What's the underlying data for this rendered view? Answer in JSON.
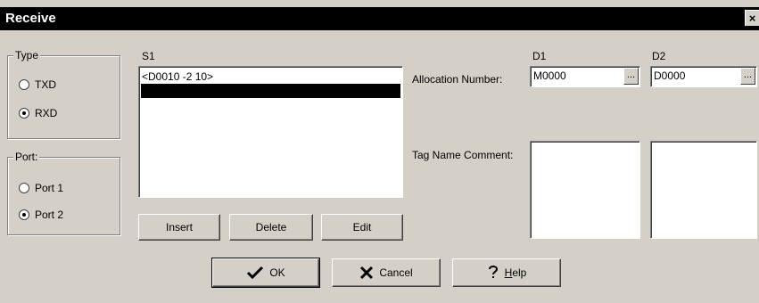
{
  "window": {
    "title": "Receive",
    "close_glyph": "×"
  },
  "type_group": {
    "label": "Type",
    "options": [
      {
        "label": "TXD",
        "checked": false
      },
      {
        "label": "RXD",
        "checked": true
      }
    ]
  },
  "port_group": {
    "label": "Port:",
    "options": [
      {
        "label": "Port 1",
        "checked": false
      },
      {
        "label": "Port 2",
        "checked": true
      }
    ]
  },
  "s1": {
    "label": "S1",
    "items": [
      "<D0010 -2 10>",
      ""
    ],
    "selected_index": 1
  },
  "list_buttons": {
    "insert": "Insert",
    "delete": "Delete",
    "edit": "Edit"
  },
  "allocation": {
    "label": "Allocation Number:",
    "d1_label": "D1",
    "d2_label": "D2",
    "d1_value": "M0000",
    "d2_value": "D0000",
    "browse_glyph": "..."
  },
  "tag_comment": {
    "label": "Tag Name Comment:"
  },
  "footer": {
    "ok": "OK",
    "cancel": "Cancel",
    "help": "Help",
    "help_hotkey": "H",
    "help_rest": "elp"
  },
  "icons": {
    "ok": "checkmark-icon",
    "cancel": "x-icon",
    "help": "question-icon"
  }
}
